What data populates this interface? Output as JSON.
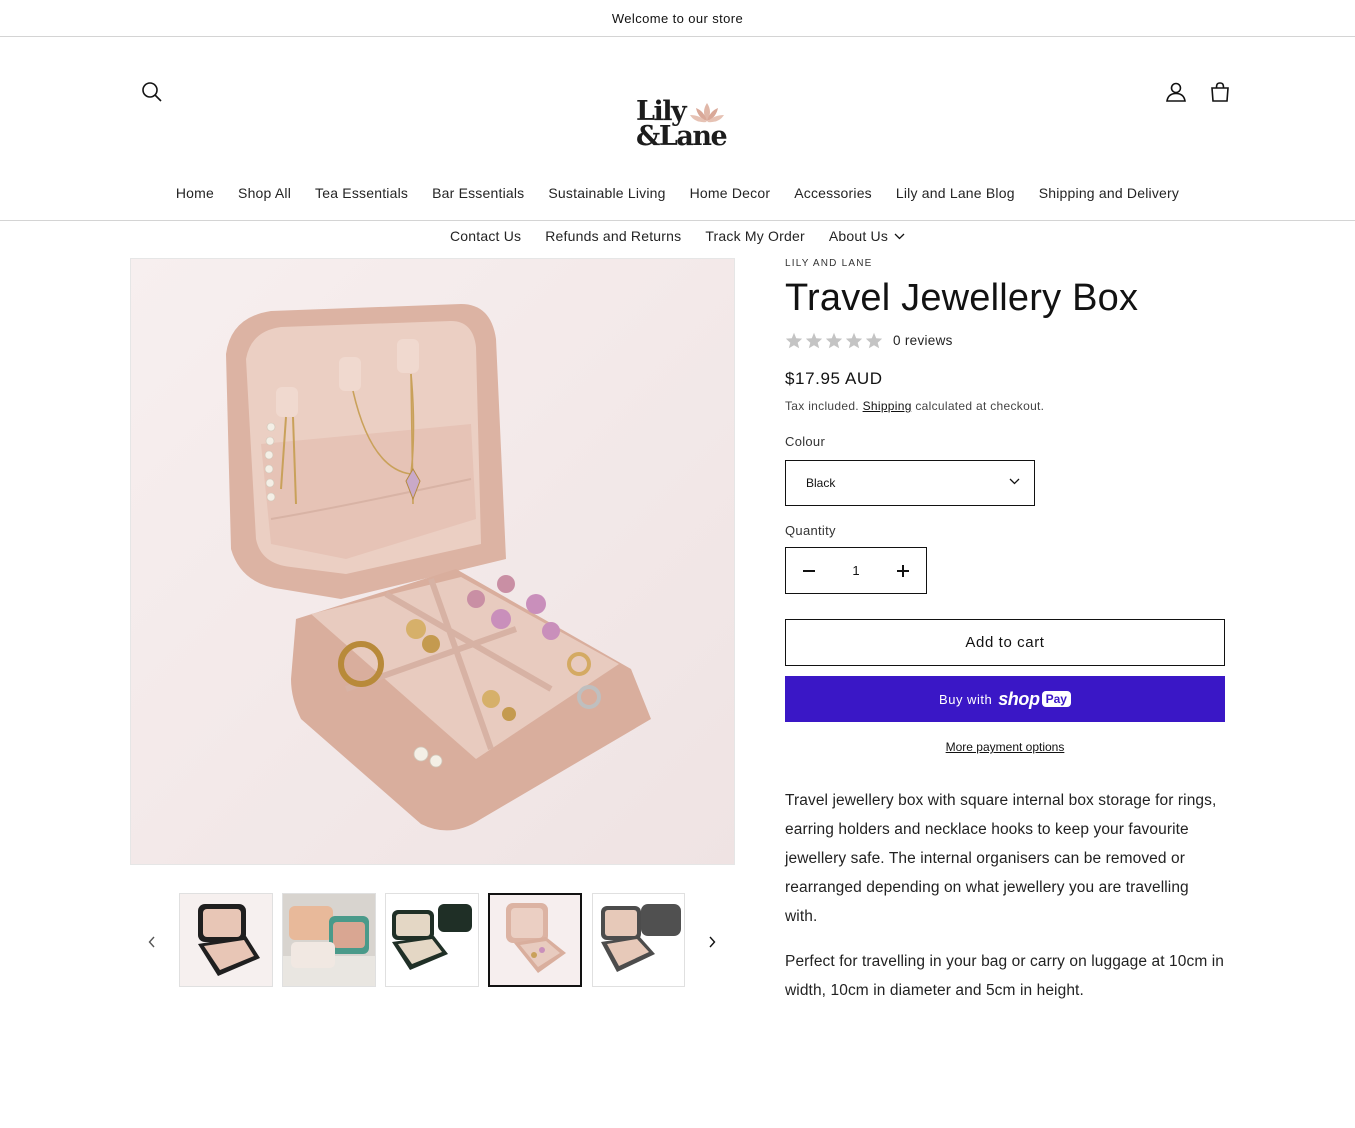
{
  "announcement": {
    "text": "Welcome to our store"
  },
  "header": {
    "logo_text_line1": "Lily",
    "logo_text_line2": "&Lane",
    "nav_row1": [
      "Home",
      "Shop All",
      "Tea Essentials",
      "Bar Essentials",
      "Sustainable Living",
      "Home Decor",
      "Accessories",
      "Lily and Lane Blog",
      "Shipping and Delivery"
    ],
    "nav_row2": [
      "Contact Us",
      "Refunds and Returns",
      "Track My Order",
      "About Us"
    ]
  },
  "gallery": {
    "thumbnails": [
      "black",
      "mint-pink",
      "dark-green",
      "pink",
      "grey"
    ],
    "active_thumbnail": 3
  },
  "product": {
    "vendor": "LILY AND LANE",
    "title": "Travel Jewellery Box",
    "rating_stars": 0,
    "reviews": "0 reviews",
    "price": "$17.95 AUD",
    "tax_prefix": "Tax included.",
    "tax_link": "Shipping",
    "tax_suffix": "calculated at checkout.",
    "colour_label": "Colour",
    "colour_value": "Black",
    "quantity_label": "Quantity",
    "quantity_value": "1",
    "add_to_cart": "Add to cart",
    "buy_with": "Buy with",
    "shop_word": "shop",
    "pay_word": "Pay",
    "more_payment": "More payment options",
    "description": [
      "Travel jewellery box with square internal box storage for rings, earring holders and necklace hooks to keep your favourite jewellery safe. The internal organisers can be removed or rearranged depending on what jewellery you are travelling with.",
      "Perfect for travelling in your bag or carry on luggage at 10cm in width, 10cm in diameter and 5cm in height."
    ]
  },
  "colors": {
    "shop_pay_purple": "#3a17c6",
    "box_pink": "#e8c6b6",
    "star_grey": "#c4c4c4"
  },
  "icons": [
    "search-icon",
    "account-icon",
    "cart-icon",
    "chevron-down-icon",
    "minus-icon",
    "plus-icon",
    "chevron-left-icon",
    "chevron-right-icon",
    "star-icon",
    "lotus-icon"
  ]
}
